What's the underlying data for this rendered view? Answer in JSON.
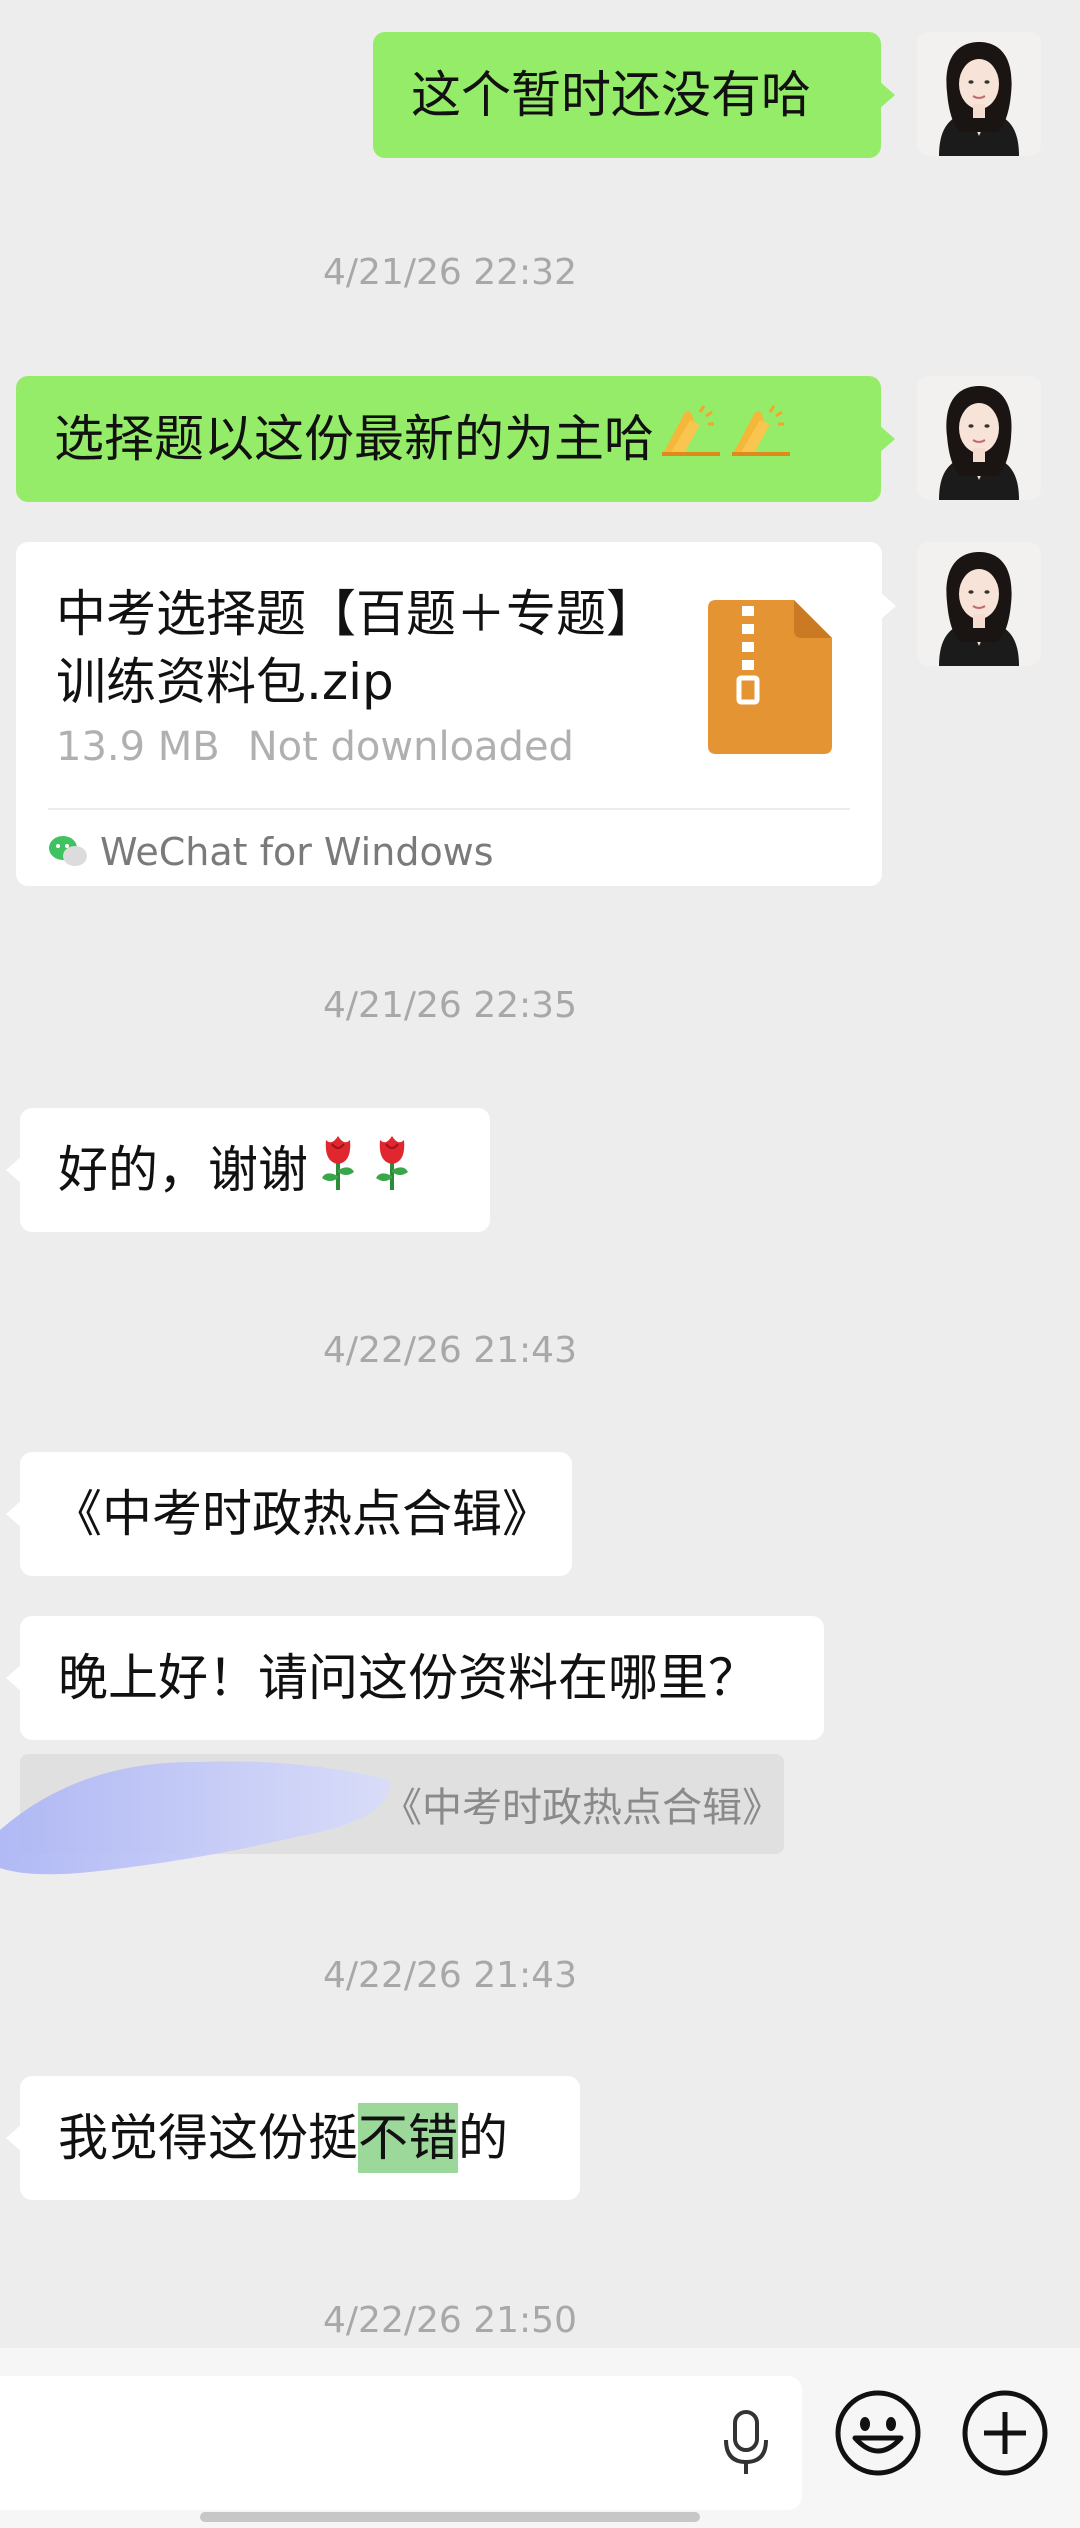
{
  "messages": {
    "m1": "这个暂时还没有哈",
    "ts1": "4/21/26 22:32",
    "m2": "选择题以这份最新的为主哈",
    "file": {
      "name": "中考选择题【百题＋专题】训练资料包.zip",
      "size": "13.9 MB",
      "status": "Not downloaded",
      "source": "WeChat for Windows"
    },
    "ts2": "4/21/26 22:35",
    "m3": "好的，谢谢",
    "ts3": "4/22/26 21:43",
    "m4": "《中考时政热点合辑》",
    "m5": "晚上好！请问这份资料在哪里？",
    "quote": "《中考时政热点合辑》",
    "ts4": "4/22/26 21:43",
    "m6a": "我觉得这份挺",
    "m6b": "不错",
    "m6c": "的",
    "ts5": "4/22/26 21:50"
  },
  "icons": {
    "reaction_emoji": "folded-hands",
    "flower_emoji": "rose",
    "file_icon": "zip-file-icon",
    "source_icon": "wechat-logo-icon",
    "mic": "microphone-icon",
    "emoji": "emoji-face-icon",
    "plus": "plus-icon"
  },
  "colors": {
    "background": "#ededed",
    "sent_bubble": "#95ec69",
    "received_bubble": "#ffffff",
    "zip_icon": "#e59433",
    "highlight": "#9bd89a"
  }
}
